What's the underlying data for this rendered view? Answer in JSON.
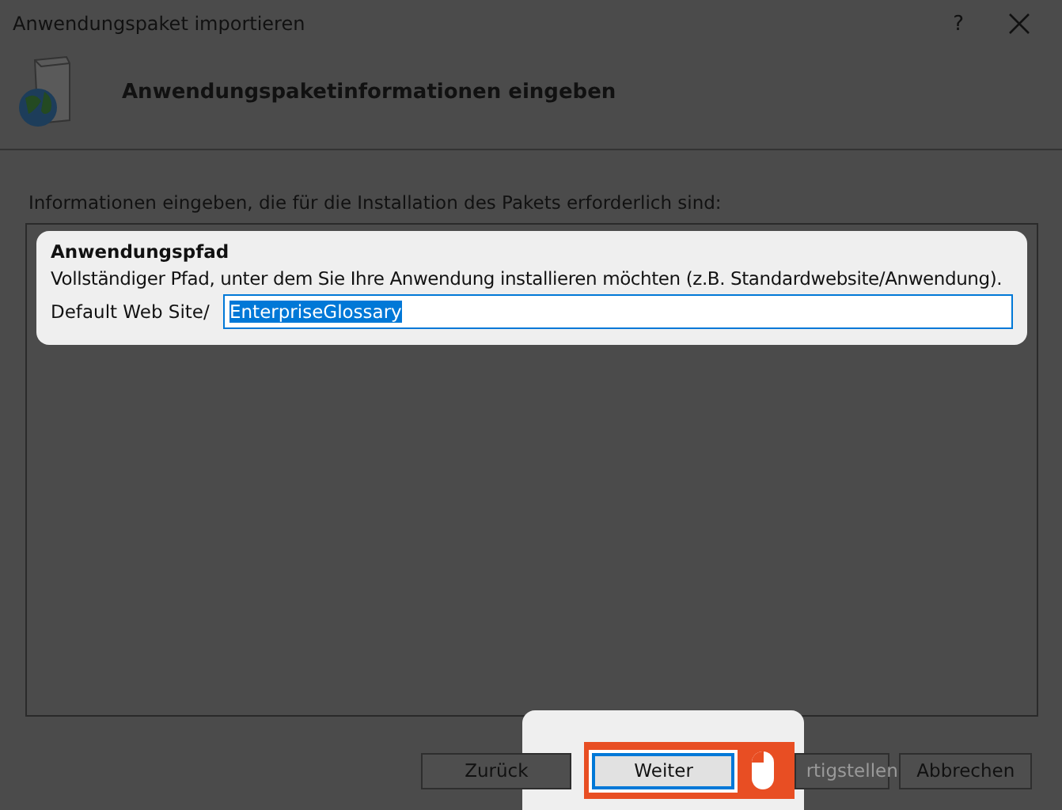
{
  "window": {
    "title": "Anwendungspaket importieren",
    "help": "?"
  },
  "header": {
    "title": "Anwendungspaketinformationen eingeben"
  },
  "instruction": "Informationen eingeben, die für die Installation des Pakets erforderlich sind:",
  "group": {
    "title": "Anwendungspfad",
    "description": "Vollständiger Pfad, unter dem Sie Ihre Anwendung installieren möchten (z.B. Standardwebsite/Anwendung).",
    "prefix": "Default Web Site/",
    "value": "EnterpriseGlossary",
    "text_selected": true
  },
  "buttons": [
    {
      "label": "Zurück",
      "kind": "normal",
      "disabled": false
    },
    {
      "label": "Weiter",
      "kind": "callout",
      "disabled": false
    },
    {
      "label": "rtigstellen",
      "kind": "covered",
      "disabled": true
    },
    {
      "label": "Abbrechen",
      "kind": "normal",
      "disabled": false
    }
  ]
}
